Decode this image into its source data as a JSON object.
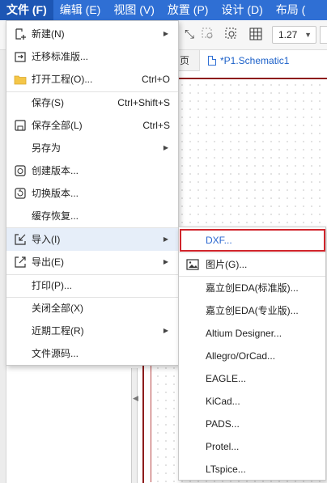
{
  "menubar": {
    "items": [
      {
        "label": "文件 (F)",
        "active": true
      },
      {
        "label": "编辑 (E)"
      },
      {
        "label": "视图 (V)"
      },
      {
        "label": "放置 (P)"
      },
      {
        "label": "设计 (D)"
      },
      {
        "label": "布局 ("
      }
    ]
  },
  "toolbar": {
    "zoom_value": "1.27"
  },
  "tabs": {
    "partial_label": "页",
    "doc_label": "*P1.Schematic1"
  },
  "file_menu": {
    "items": [
      {
        "label": "新建(N)",
        "icon": "new-file-icon",
        "submenu": true
      },
      {
        "label": "迁移标准版...",
        "icon": "migrate-icon"
      },
      {
        "label": "打开工程(O)...",
        "icon": "folder-icon",
        "shortcut": "Ctrl+O"
      },
      {
        "label": "保存(S)",
        "shortcut": "Ctrl+Shift+S"
      },
      {
        "label": "保存全部(L)",
        "icon": "save-icon",
        "shortcut": "Ctrl+S"
      },
      {
        "label": "另存为",
        "submenu": true
      },
      {
        "label": "创建版本...",
        "icon": "create-version-icon"
      },
      {
        "label": "切换版本...",
        "icon": "switch-version-icon"
      },
      {
        "label": "缓存恢复..."
      },
      {
        "label": "导入(I)",
        "icon": "import-icon",
        "submenu": true,
        "hover": true
      },
      {
        "label": "导出(E)",
        "icon": "export-icon",
        "submenu": true
      },
      {
        "label": "打印(P)..."
      },
      {
        "label": "关闭全部(X)"
      },
      {
        "label": "近期工程(R)",
        "submenu": true
      },
      {
        "label": "文件源码..."
      }
    ]
  },
  "import_menu": {
    "items": [
      {
        "label": "DXF..."
      },
      {
        "label": "图片(G)...",
        "icon": "image-icon"
      },
      {
        "label": "嘉立创EDA(标准版)..."
      },
      {
        "label": "嘉立创EDA(专业版)..."
      },
      {
        "label": "Altium Designer..."
      },
      {
        "label": "Allegro/OrCad..."
      },
      {
        "label": "EAGLE..."
      },
      {
        "label": "KiCad..."
      },
      {
        "label": "PADS..."
      },
      {
        "label": "Protel..."
      },
      {
        "label": "LTspice..."
      }
    ]
  },
  "colors": {
    "menubar": "#2f6fd4",
    "highlight_box": "#d0242b",
    "hover_row": "#e6eef9",
    "sheet_border": "#8d1c1c"
  }
}
